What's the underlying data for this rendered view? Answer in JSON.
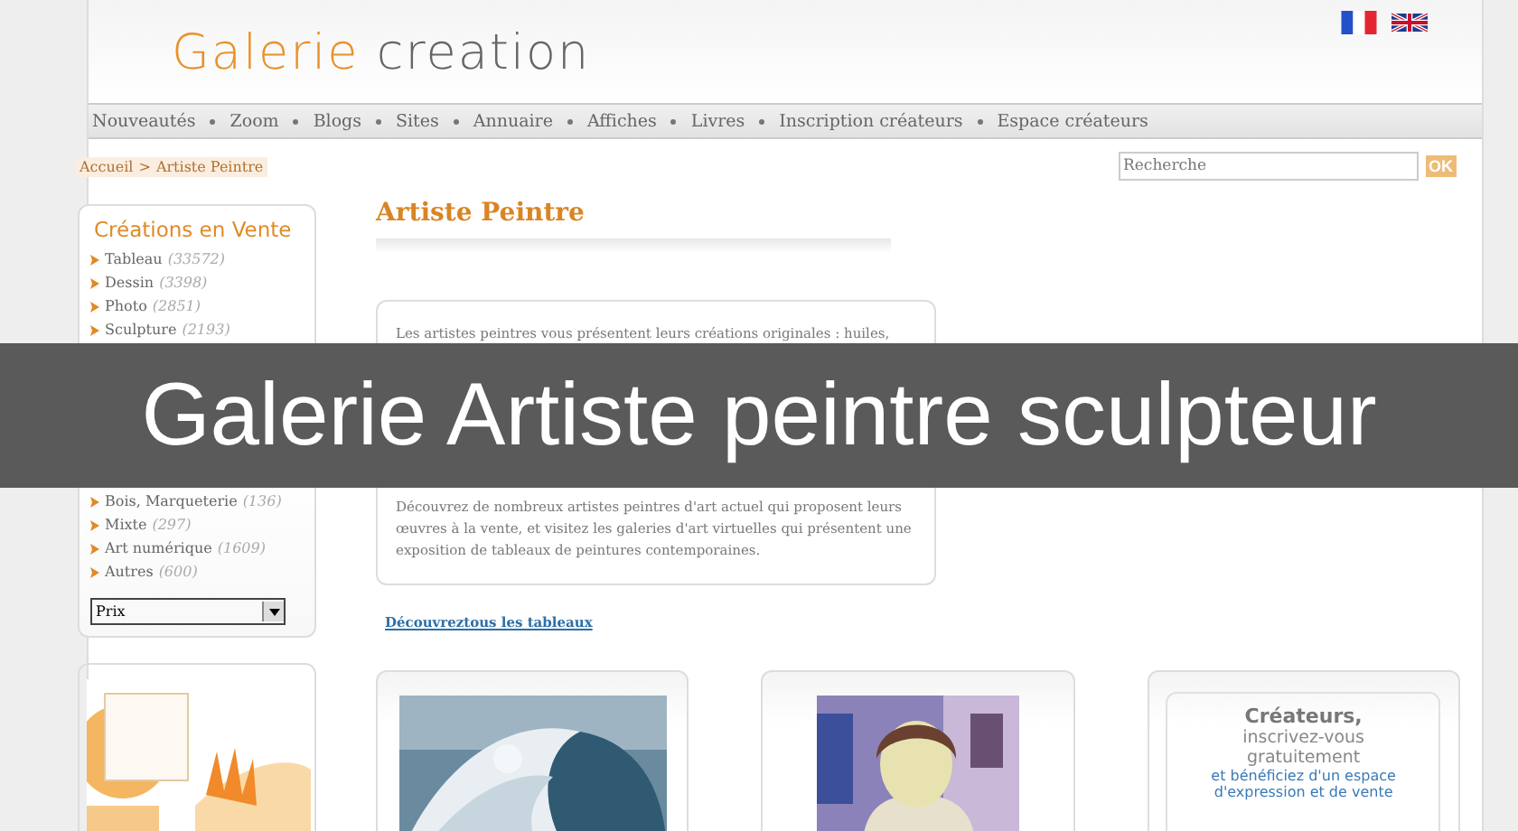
{
  "header": {
    "logo_first": "Galerie",
    "logo_second": "creation"
  },
  "nav": [
    "Nouveautés",
    "Zoom",
    "Blogs",
    "Sites",
    "Annuaire",
    "Affiches",
    "Livres",
    "Inscription créateurs",
    "Espace créateurs"
  ],
  "breadcrumb": {
    "home": "Accueil",
    "separator": ">",
    "current": "Artiste Peintre"
  },
  "search": {
    "placeholder": "Recherche",
    "button": "OK"
  },
  "sidebar": {
    "title": "Créations en Vente",
    "items_above": [
      {
        "label": "Tableau",
        "count": "(33572)"
      },
      {
        "label": "Dessin",
        "count": "(3398)"
      },
      {
        "label": "Photo",
        "count": "(2851)"
      },
      {
        "label": "Sculpture",
        "count": "(2193)"
      }
    ],
    "items_below": [
      {
        "label": "Bois, Marqueterie",
        "count": "(136)"
      },
      {
        "label": "Mixte",
        "count": "(297)"
      },
      {
        "label": "Art numérique",
        "count": "(1609)"
      },
      {
        "label": "Autres",
        "count": "(600)"
      }
    ],
    "sort": {
      "value": "Prix"
    }
  },
  "main": {
    "title": "Artiste Peintre",
    "text_above": "Les artistes peintres vous présentent leurs créations originales : huiles,",
    "text_below": "Découvrez de nombreux artistes peintres d'art actuel qui proposent leurs œuvres à la vente, et visitez les galeries d'art virtuelles qui présentent une exposition de tableaux de peintures contemporaines.",
    "link": "Découvreztous les tableaux"
  },
  "cards": [
    {
      "kind": "picture"
    },
    {
      "kind": "picture"
    },
    {
      "kind": "promo",
      "title": "Créateurs,",
      "lines": [
        "inscrivez-vous",
        "gratuitement"
      ],
      "highlight": [
        "et bénéficiez d'un espace",
        "d'expression et de vente"
      ]
    }
  ],
  "banner": {
    "title": "Galerie Artiste peintre sculpteur"
  }
}
